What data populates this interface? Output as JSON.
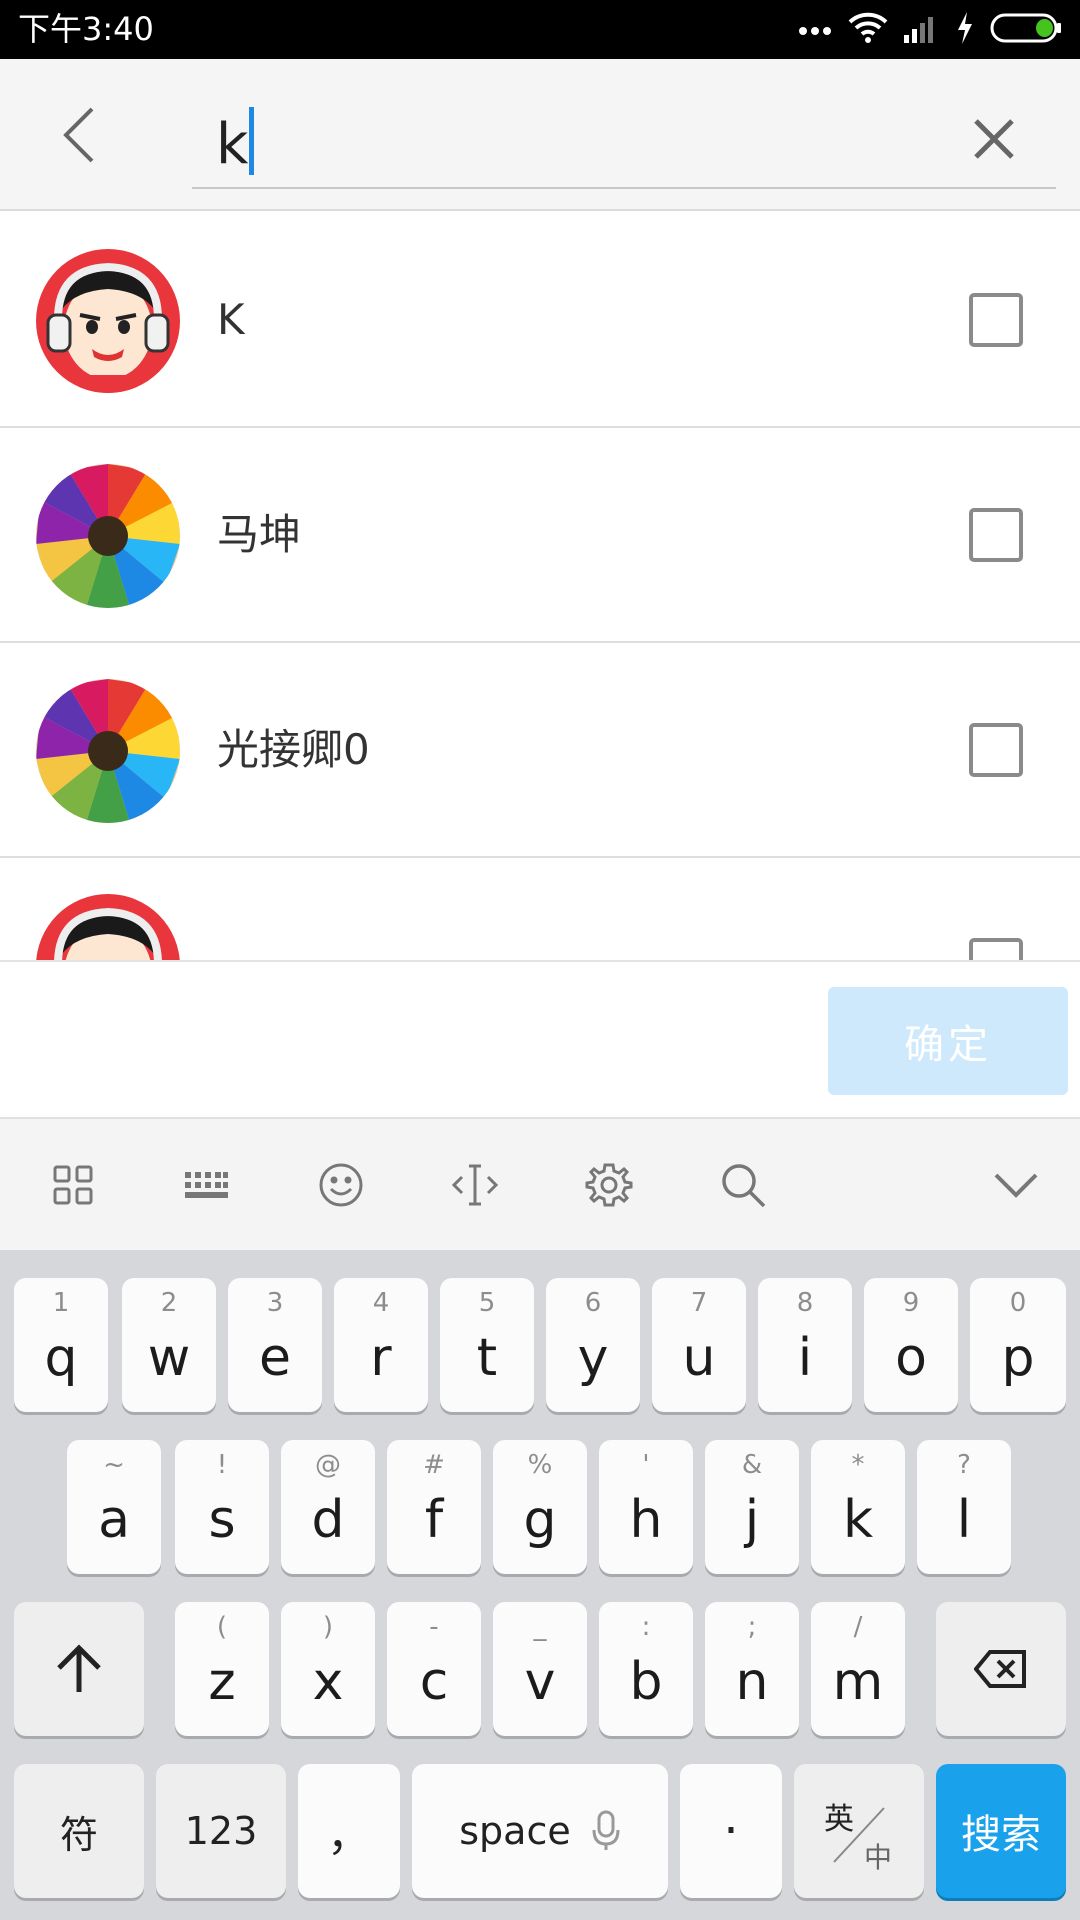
{
  "status_bar": {
    "time": "下午3:40",
    "icons": [
      "more-dots-icon",
      "wifi-icon",
      "signal-icon",
      "charging-icon",
      "battery-icon"
    ],
    "battery_color": "#44c41c"
  },
  "search": {
    "query": "k",
    "icons": [
      "back-arrow-icon",
      "clear-x-icon"
    ],
    "caret_color": "#1e88e5"
  },
  "contacts": [
    {
      "name": "K",
      "avatar": "cartoon-headphones-avatar",
      "checked": false
    },
    {
      "name": "马坤",
      "avatar": "color-pencils-avatar",
      "checked": false
    },
    {
      "name": "光接卿0",
      "avatar": "color-pencils-avatar",
      "checked": false
    },
    {
      "name": "",
      "avatar": "cartoon-headphones-avatar",
      "checked": false
    }
  ],
  "confirm": {
    "label": "确定",
    "color": "#cde9fb"
  },
  "keyboard": {
    "toolbar_icons": [
      "grid-icon",
      "keyboard-icon",
      "emoji-icon",
      "cursor-icon",
      "settings-icon",
      "search-icon",
      "collapse-chevron-icon"
    ],
    "row1": [
      {
        "main": "q",
        "hint": "1"
      },
      {
        "main": "w",
        "hint": "2"
      },
      {
        "main": "e",
        "hint": "3"
      },
      {
        "main": "r",
        "hint": "4"
      },
      {
        "main": "t",
        "hint": "5"
      },
      {
        "main": "y",
        "hint": "6"
      },
      {
        "main": "u",
        "hint": "7"
      },
      {
        "main": "i",
        "hint": "8"
      },
      {
        "main": "o",
        "hint": "9"
      },
      {
        "main": "p",
        "hint": "0"
      }
    ],
    "row2": [
      {
        "main": "a",
        "hint": "~"
      },
      {
        "main": "s",
        "hint": "!"
      },
      {
        "main": "d",
        "hint": "@"
      },
      {
        "main": "f",
        "hint": "#"
      },
      {
        "main": "g",
        "hint": "%"
      },
      {
        "main": "h",
        "hint": "'"
      },
      {
        "main": "j",
        "hint": "&"
      },
      {
        "main": "k",
        "hint": "*"
      },
      {
        "main": "l",
        "hint": "?"
      }
    ],
    "row3": [
      {
        "main": "z",
        "hint": "("
      },
      {
        "main": "x",
        "hint": ")"
      },
      {
        "main": "c",
        "hint": "-"
      },
      {
        "main": "v",
        "hint": "_"
      },
      {
        "main": "b",
        "hint": ":"
      },
      {
        "main": "n",
        "hint": ";"
      },
      {
        "main": "m",
        "hint": "/"
      }
    ],
    "shift_icon": "shift-arrow-icon",
    "backspace_icon": "backspace-icon",
    "symbols_label": "符",
    "numbers_label": "123",
    "comma_label": "，",
    "space_label": "space",
    "mic_icon": "microphone-icon",
    "period_label": "·",
    "lang_top": "英",
    "lang_bottom": "中",
    "search_label": "搜索",
    "search_key_color": "#1aa1ec"
  }
}
